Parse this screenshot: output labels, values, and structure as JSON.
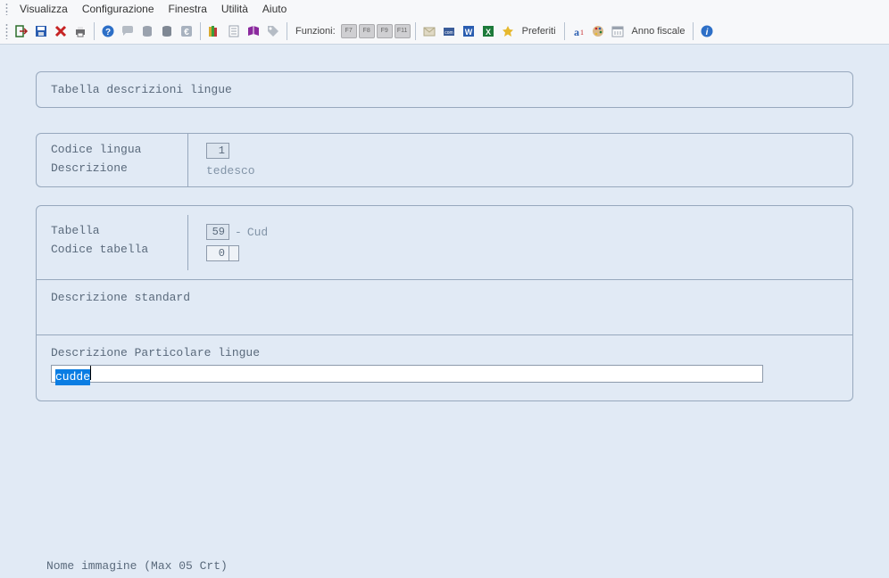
{
  "menu": {
    "items": [
      "Visualizza",
      "Configurazione",
      "Finestra",
      "Utilità",
      "Aiuto"
    ]
  },
  "toolbar": {
    "funzioni_label": "Funzioni:",
    "fkeys": [
      "F7",
      "F8",
      "F9",
      "F11"
    ],
    "preferiti_label": "Preferiti",
    "anno_fiscale_label": "Anno fiscale"
  },
  "page": {
    "title": "Tabella descrizioni lingue",
    "fields": {
      "codice_lingua_label": "Codice lingua",
      "codice_lingua_value": "1",
      "descrizione_label": "Descrizione",
      "descrizione_value": "tedesco",
      "tabella_label": "Tabella",
      "tabella_code": "59",
      "tabella_separator": "-",
      "tabella_name": "Cud",
      "codice_tabella_label": "Codice tabella",
      "codice_tabella_value": "0",
      "descrizione_standard_label": "Descrizione standard",
      "descrizione_particolare_label": "Descrizione Particolare lingue",
      "descrizione_particolare_value": "cudde"
    },
    "footer_label": "Nome immagine (Max 05 Crt)"
  }
}
